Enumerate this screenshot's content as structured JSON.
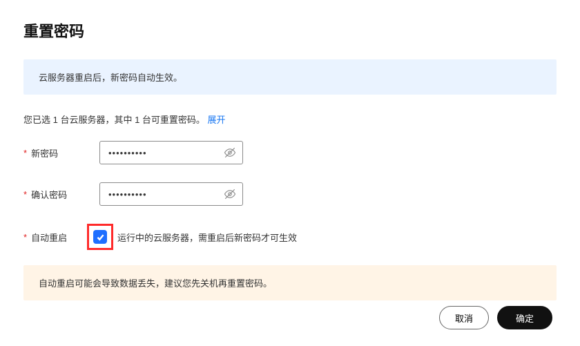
{
  "title": "重置密码",
  "info_banner": "云服务器重启后，新密码自动生效。",
  "selection_text": "您已选 1 台云服务器，其中 1 台可重置密码。",
  "expand_label": "展开",
  "fields": {
    "new_password": {
      "label": "新密码",
      "value": "••••••••••"
    },
    "confirm_password": {
      "label": "确认密码",
      "value": "••••••••••"
    },
    "auto_restart": {
      "label": "自动重启",
      "hint": "运行中的云服务器，需重启后新密码才可生效",
      "checked": true
    }
  },
  "warn_banner": "自动重启可能会导致数据丢失，建议您先关机再重置密码。",
  "buttons": {
    "cancel": "取消",
    "confirm": "确定"
  }
}
